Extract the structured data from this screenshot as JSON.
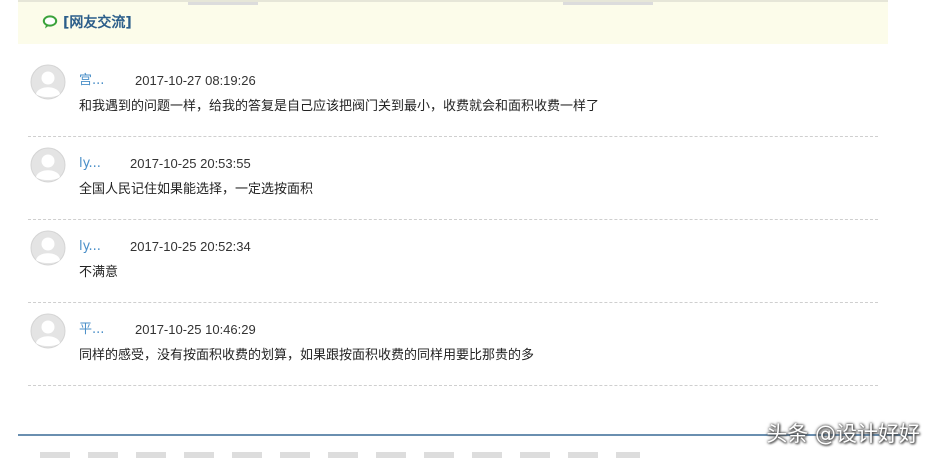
{
  "section": {
    "title": "[网友交流]",
    "icon": "speech-bubble-icon",
    "accent": "#2c5e8a",
    "background": "#fcfcea"
  },
  "comments": [
    {
      "username": "宫...",
      "timestamp": "2017-10-27 08:19:26",
      "content": "和我遇到的问题一样，给我的答复是自己应该把阀门关到最小，收费就会和面积收费一样了"
    },
    {
      "username": "ly...",
      "timestamp": "2017-10-25 20:53:55",
      "content": "全国人民记住如果能选择，一定选按面积"
    },
    {
      "username": "ly...",
      "timestamp": "2017-10-25 20:52:34",
      "content": "不满意"
    },
    {
      "username": "平...",
      "timestamp": "2017-10-25 10:46:29",
      "content": "同样的感受，没有按面积收费的划算，如果跟按面积收费的同样用要比那贵的多"
    }
  ],
  "colors": {
    "username": "#4a8fc8",
    "divider": "#cfcfcf",
    "bottom_rule": "#6a8fb0"
  },
  "watermark": "头条 @设计好好"
}
